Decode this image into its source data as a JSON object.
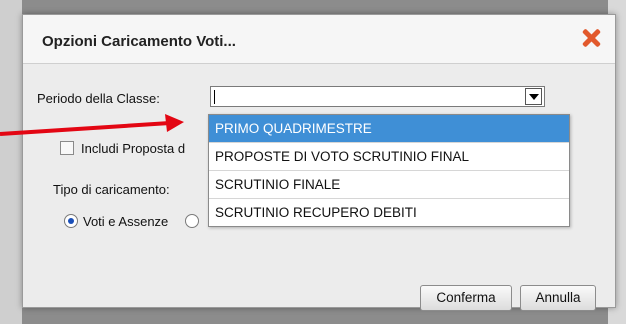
{
  "dialog": {
    "title": "Opzioni Caricamento Voti...",
    "close_icon": "close-icon"
  },
  "form": {
    "periodo_label": "Periodo della Classe:",
    "periodo_value": "",
    "includi_label": "Includi Proposta d",
    "includi_checked": false,
    "tipo_label": "Tipo di caricamento:",
    "radio_voti_label": "Voti e Assenze",
    "radio_voti_checked": true
  },
  "dropdown": {
    "items": [
      {
        "label": "PRIMO QUADRIMESTRE",
        "highlighted": true
      },
      {
        "label": "PROPOSTE DI VOTO SCRUTINIO FINAL",
        "highlighted": false
      },
      {
        "label": "SCRUTINIO FINALE",
        "highlighted": false
      },
      {
        "label": "SCRUTINIO RECUPERO DEBITI",
        "highlighted": false
      }
    ]
  },
  "buttons": {
    "confirm": "Conferma",
    "cancel": "Annulla"
  },
  "colors": {
    "highlight": "#3f8fd6",
    "close_icon": "#e2592c",
    "annotation_arrow": "#e30613"
  },
  "annotation": {
    "icon": "red-arrow-icon"
  }
}
